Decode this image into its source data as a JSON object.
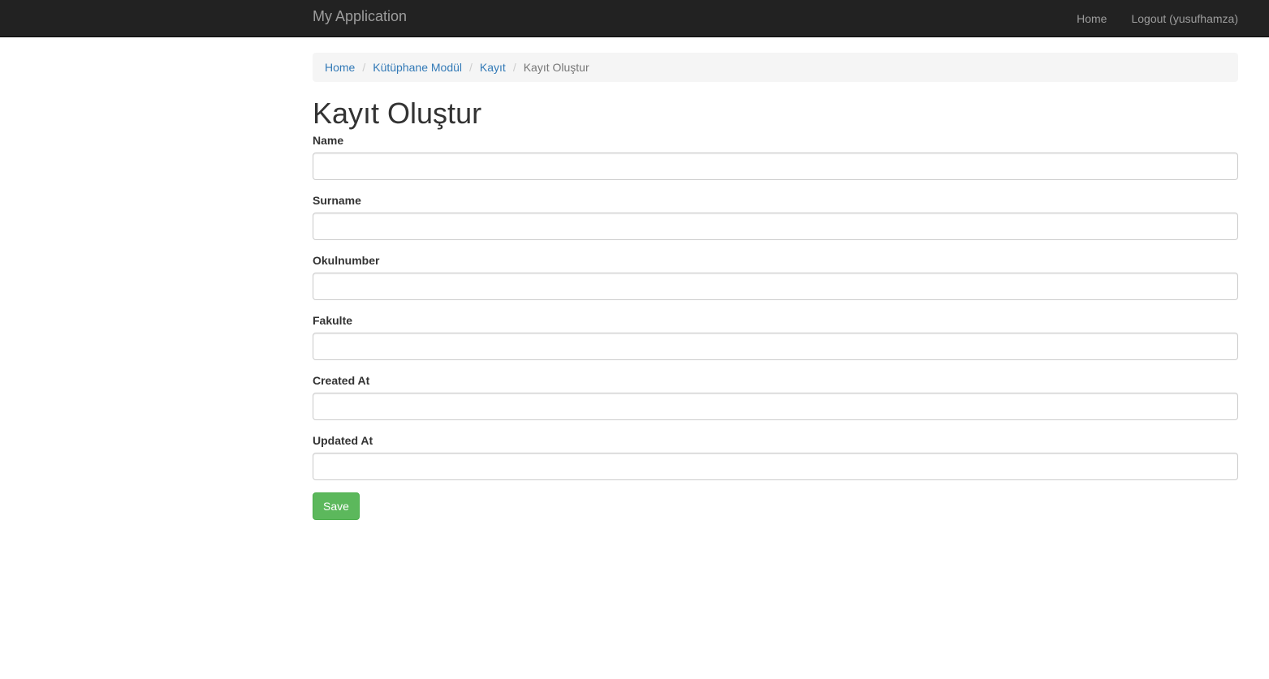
{
  "navbar": {
    "brand": "My Application",
    "links": [
      {
        "label": "Home"
      },
      {
        "label": "Logout (yusufhamza)"
      }
    ]
  },
  "breadcrumb": {
    "items": [
      "Home",
      "Kütüphane Modül",
      "Kayıt"
    ],
    "separator": "/",
    "active": "Kayıt Oluştur"
  },
  "page": {
    "title": "Kayıt Oluştur"
  },
  "form": {
    "fields": [
      {
        "label": "Name",
        "value": "",
        "placeholder": ""
      },
      {
        "label": "Surname",
        "value": "",
        "placeholder": ""
      },
      {
        "label": "Okulnumber",
        "value": "",
        "placeholder": ""
      },
      {
        "label": "Fakulte",
        "value": "",
        "placeholder": ""
      },
      {
        "label": "Created At",
        "value": "",
        "placeholder": ""
      },
      {
        "label": "Updated At",
        "value": "",
        "placeholder": ""
      }
    ],
    "save_label": "Save"
  },
  "colors": {
    "navbar_bg": "#222222",
    "nav_text": "#9d9d9d",
    "link": "#337ab7",
    "save_button": "#5cb85c"
  }
}
